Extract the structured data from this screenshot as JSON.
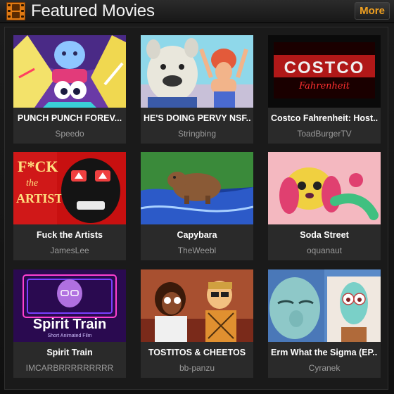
{
  "header": {
    "title": "Featured Movies",
    "more_label": "More",
    "accent_color": "#f0a020",
    "icon": "film-icon"
  },
  "movies": [
    {
      "title": "PUNCH PUNCH FOREV...",
      "author": "Speedo"
    },
    {
      "title": "HE'S DOING PERVY NSF...",
      "author": "Stringbing"
    },
    {
      "title": "Costco Fahrenheit: Host...",
      "author": "ToadBurgerTV",
      "thumb_text": [
        "COSTCO",
        "Fahrenheit"
      ]
    },
    {
      "title": "Fuck the Artists",
      "author": "JamesLee",
      "thumb_text": [
        "F*CK",
        "the",
        "ARTISTS"
      ]
    },
    {
      "title": "Capybara",
      "author": "TheWeebl"
    },
    {
      "title": "Soda Street",
      "author": "oquanaut"
    },
    {
      "title": "Spirit Train",
      "author": "IMCARBRRRRRRRRR",
      "thumb_text": [
        "Spirit Train",
        "Short Animated Film"
      ]
    },
    {
      "title": "TOSTITOS & CHEETOS",
      "author": "bb-panzu"
    },
    {
      "title": "Erm What the Sigma (EP...",
      "author": "Cyranek"
    }
  ]
}
